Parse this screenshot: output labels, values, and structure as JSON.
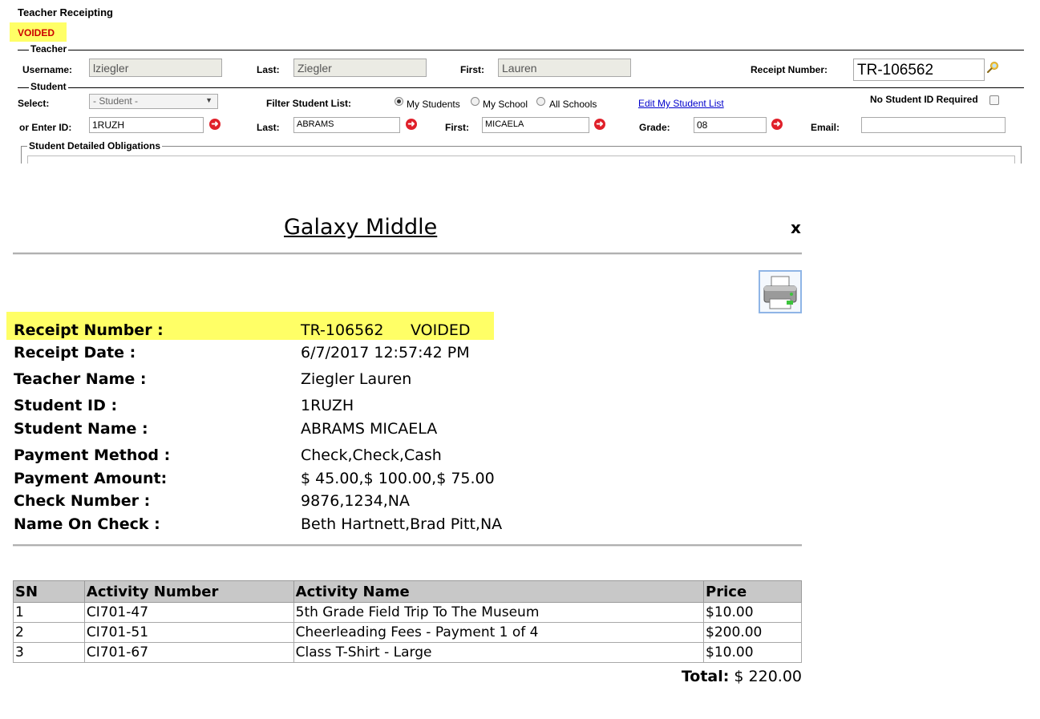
{
  "form": {
    "title": "Teacher Receipting",
    "status": "VOIDED",
    "teacher_legend": "Teacher",
    "username_label": "Username:",
    "username_value": "lziegler",
    "last_label": "Last:",
    "last_value": "Ziegler",
    "first_label": "First:",
    "first_value": "Lauren",
    "receipt_number_label": "Receipt Number:",
    "receipt_number_value": "TR-106562",
    "student_legend": "Student",
    "select_label": "Select:",
    "student_select_value": "- Student -",
    "filter_label": "Filter Student List:",
    "filter_options": [
      "My Students",
      "My School",
      "All Schools"
    ],
    "edit_link": "Edit My Student List",
    "no_id_label": "No Student ID Required",
    "enter_id_label": "or Enter ID:",
    "enter_id_value": "1RUZH",
    "student_last_label": "Last:",
    "student_last_value": "ABRAMS",
    "student_first_label": "First:",
    "student_first_value": "MICAELA",
    "grade_label": "Grade:",
    "grade_value": "08",
    "email_label": "Email:",
    "email_value": "",
    "obligations_legend": "Student Detailed Obligations"
  },
  "receipt": {
    "school": "Galaxy Middle",
    "close": "x",
    "fields": [
      {
        "label": "Receipt Number :",
        "value": "TR-106562"
      },
      {
        "label": "Receipt Date :",
        "value": "6/7/2017 12:57:42 PM"
      },
      {
        "label": "Teacher Name :",
        "value": "Ziegler Lauren"
      },
      {
        "label": "Student ID :",
        "value": "1RUZH"
      },
      {
        "label": "Student Name :",
        "value": "ABRAMS MICAELA"
      },
      {
        "label": "Payment Method :",
        "value": "Check,Check,Cash"
      },
      {
        "label": "Payment Amount:",
        "value": "$ 45.00,$ 100.00,$ 75.00"
      },
      {
        "label": "Check Number :",
        "value": "9876,1234,NA"
      },
      {
        "label": "Name On Check :",
        "value": "Beth Hartnett,Brad Pitt,NA"
      }
    ],
    "void_status": "VOIDED",
    "table": {
      "headers": [
        "SN",
        "Activity Number",
        "Activity Name",
        "Price"
      ],
      "rows": [
        [
          "1",
          "CI701-47",
          "5th Grade Field Trip To The Museum",
          "$10.00"
        ],
        [
          "2",
          "CI701-51",
          "Cheerleading Fees - Payment 1 of 4",
          "$200.00"
        ],
        [
          "3",
          "CI701-67",
          "Class T-Shirt - Large",
          "$10.00"
        ]
      ]
    },
    "total_label": "Total:",
    "total_value": "$ 220.00"
  },
  "colors": {
    "highlight": "#ffff66",
    "void_red": "#cc0000",
    "link_blue": "#0000cc",
    "clear_icon_red": "#e0202a"
  },
  "icons": [
    "search-icon",
    "clear-icon",
    "printer-icon",
    "close-icon",
    "chevron-down-icon"
  ]
}
